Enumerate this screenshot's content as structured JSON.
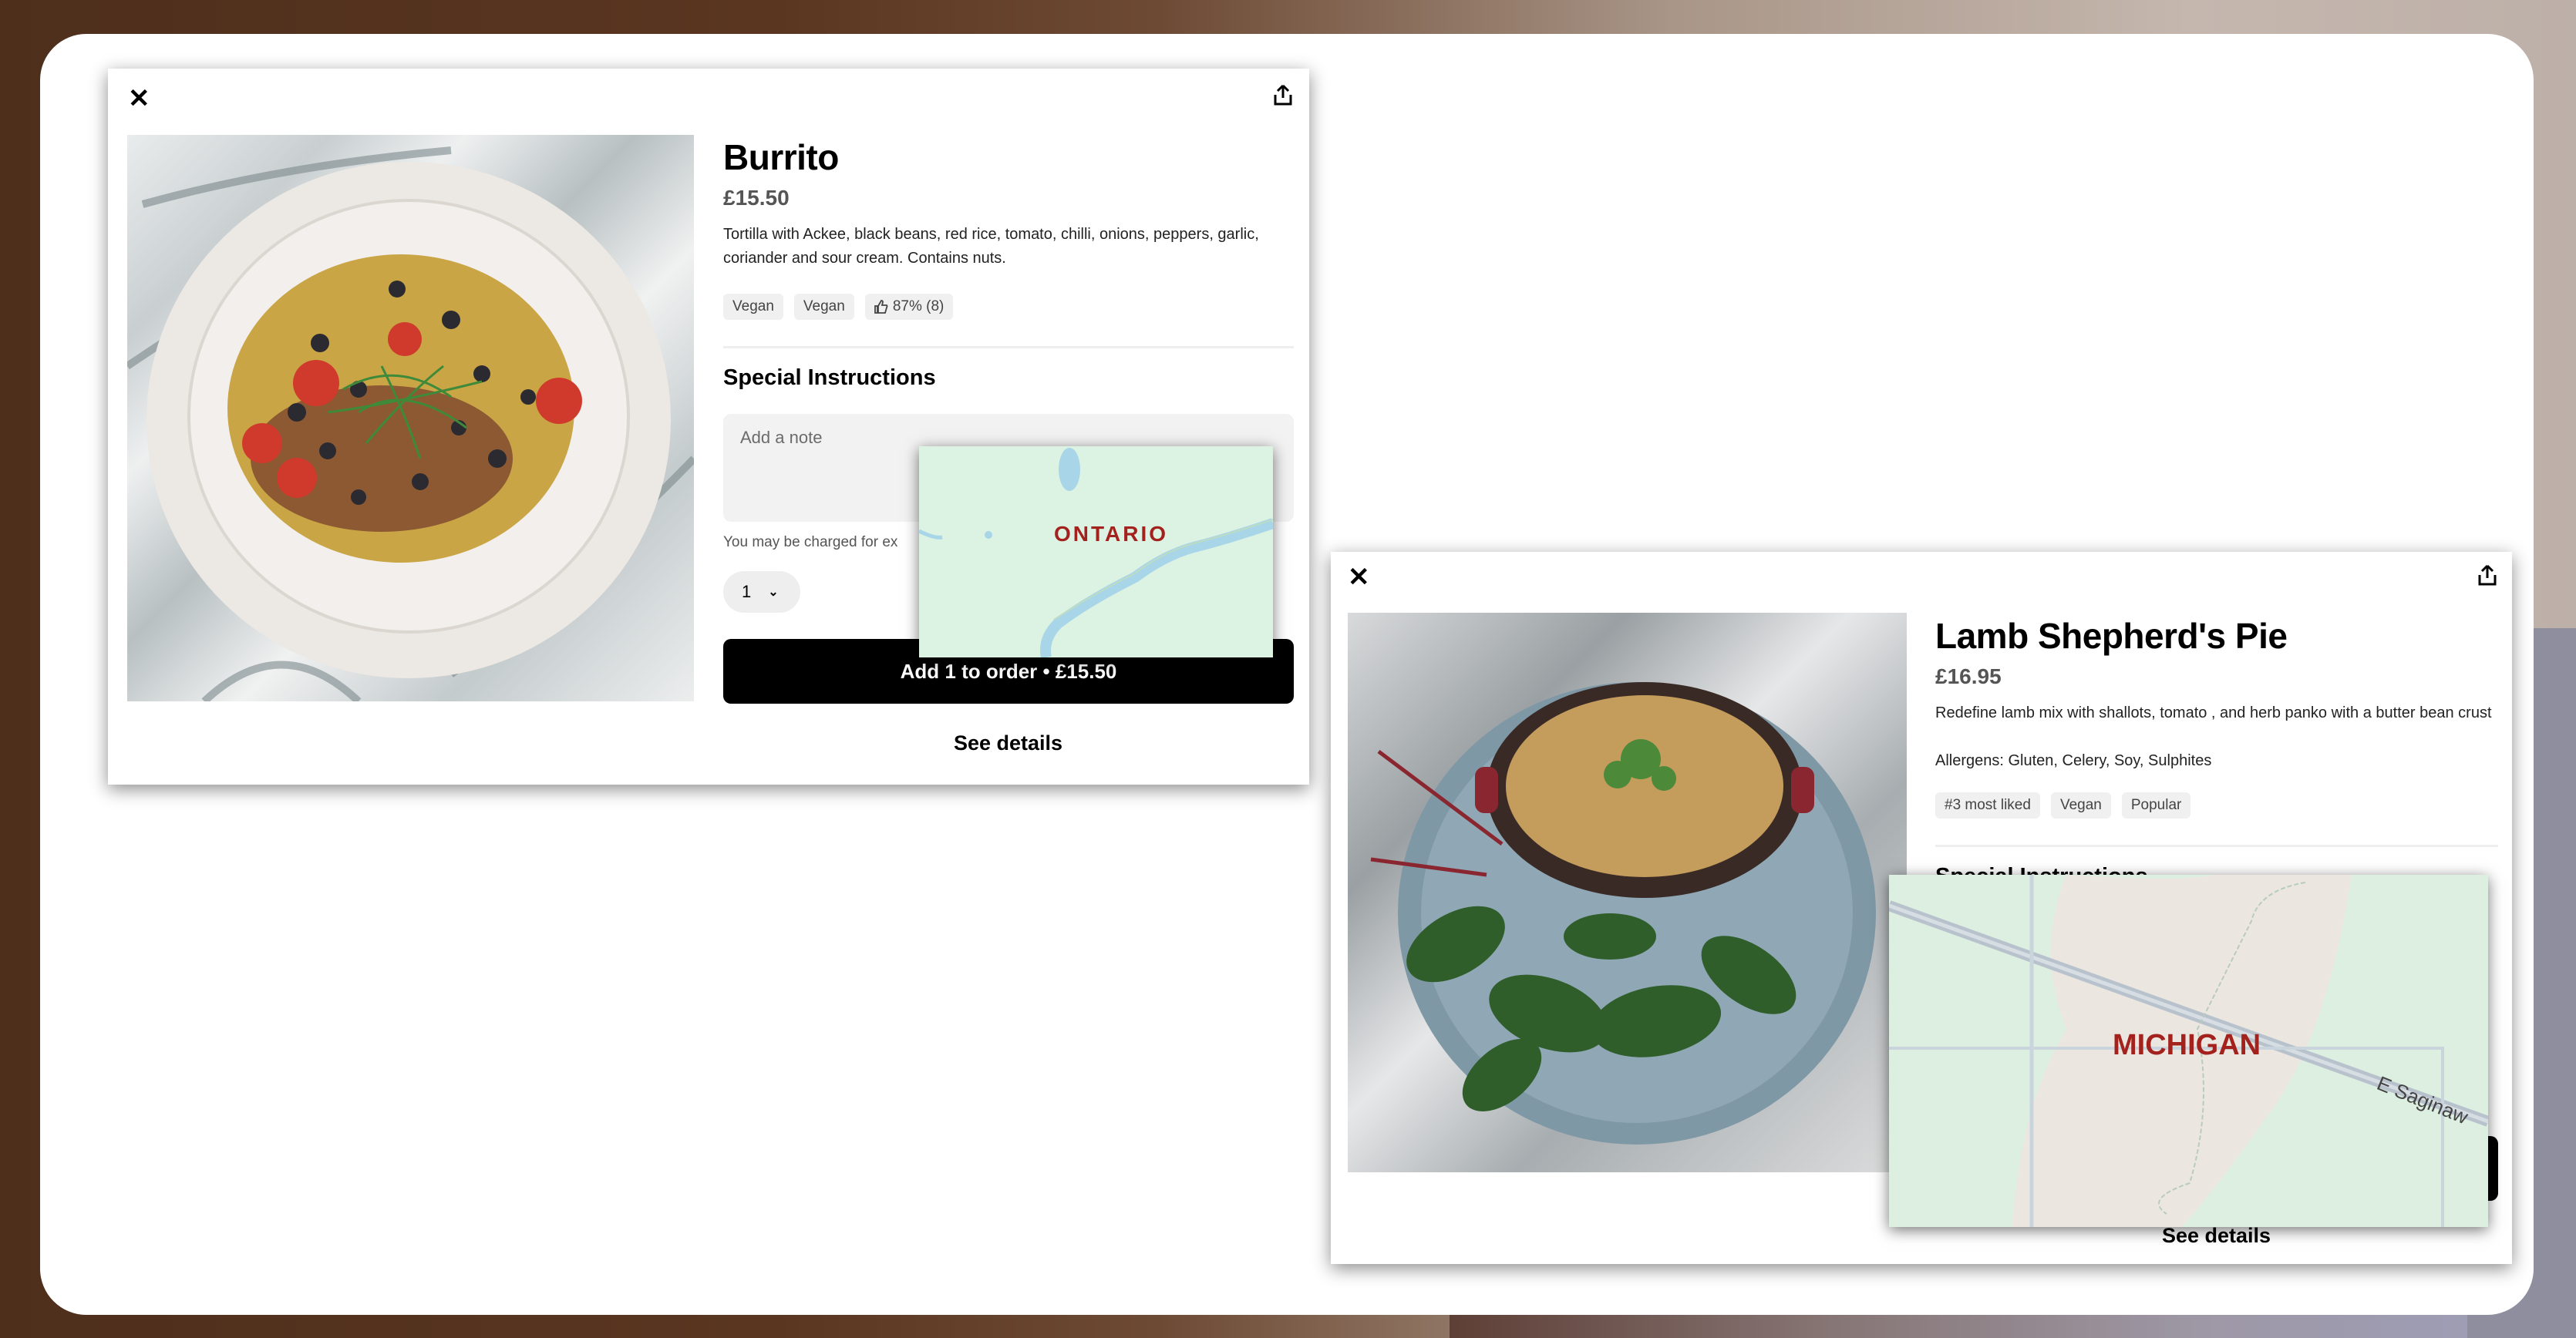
{
  "cards": [
    {
      "name": "Burrito",
      "price": "£15.50",
      "description": "Tortilla with Ackee, black beans, red rice, tomato, chilli, onions, peppers, garlic, coriander and sour cream. Contains nuts.",
      "tags": [
        "Vegan",
        "Vegan"
      ],
      "rating": "87% (8)",
      "special_instructions_label": "Special Instructions",
      "note_placeholder": "Add a note",
      "charge_hint": "You may be charged for ex",
      "quantity": "1",
      "add_button": "Add 1 to order • £15.50",
      "see_details": "See details",
      "map_label": "ONTARIO"
    },
    {
      "name": "Lamb Shepherd's Pie",
      "price": "£16.95",
      "description": "Redefine lamb mix with shallots, tomato , and herb panko with a butter bean crust",
      "allergens": "Allergens: Gluten, Celery, Soy, Sulphites",
      "tags": [
        "#3 most liked",
        "Vegan",
        "Popular"
      ],
      "special_instructions_label": "Special Instructions",
      "see_details": "See details",
      "map_label": "MICHIGAN",
      "road_label": "E Saginaw"
    }
  ],
  "icons": {
    "close": "close-icon",
    "share": "share-icon",
    "thumbs_up": "thumbs-up-icon",
    "chevron": "chevron-down-icon"
  },
  "colors": {
    "map_label": "#a3221e",
    "button": "#000000",
    "tag_bg": "#f0f0f0",
    "map_land": "#dcf2e2",
    "map_water": "#a8d5e8"
  }
}
